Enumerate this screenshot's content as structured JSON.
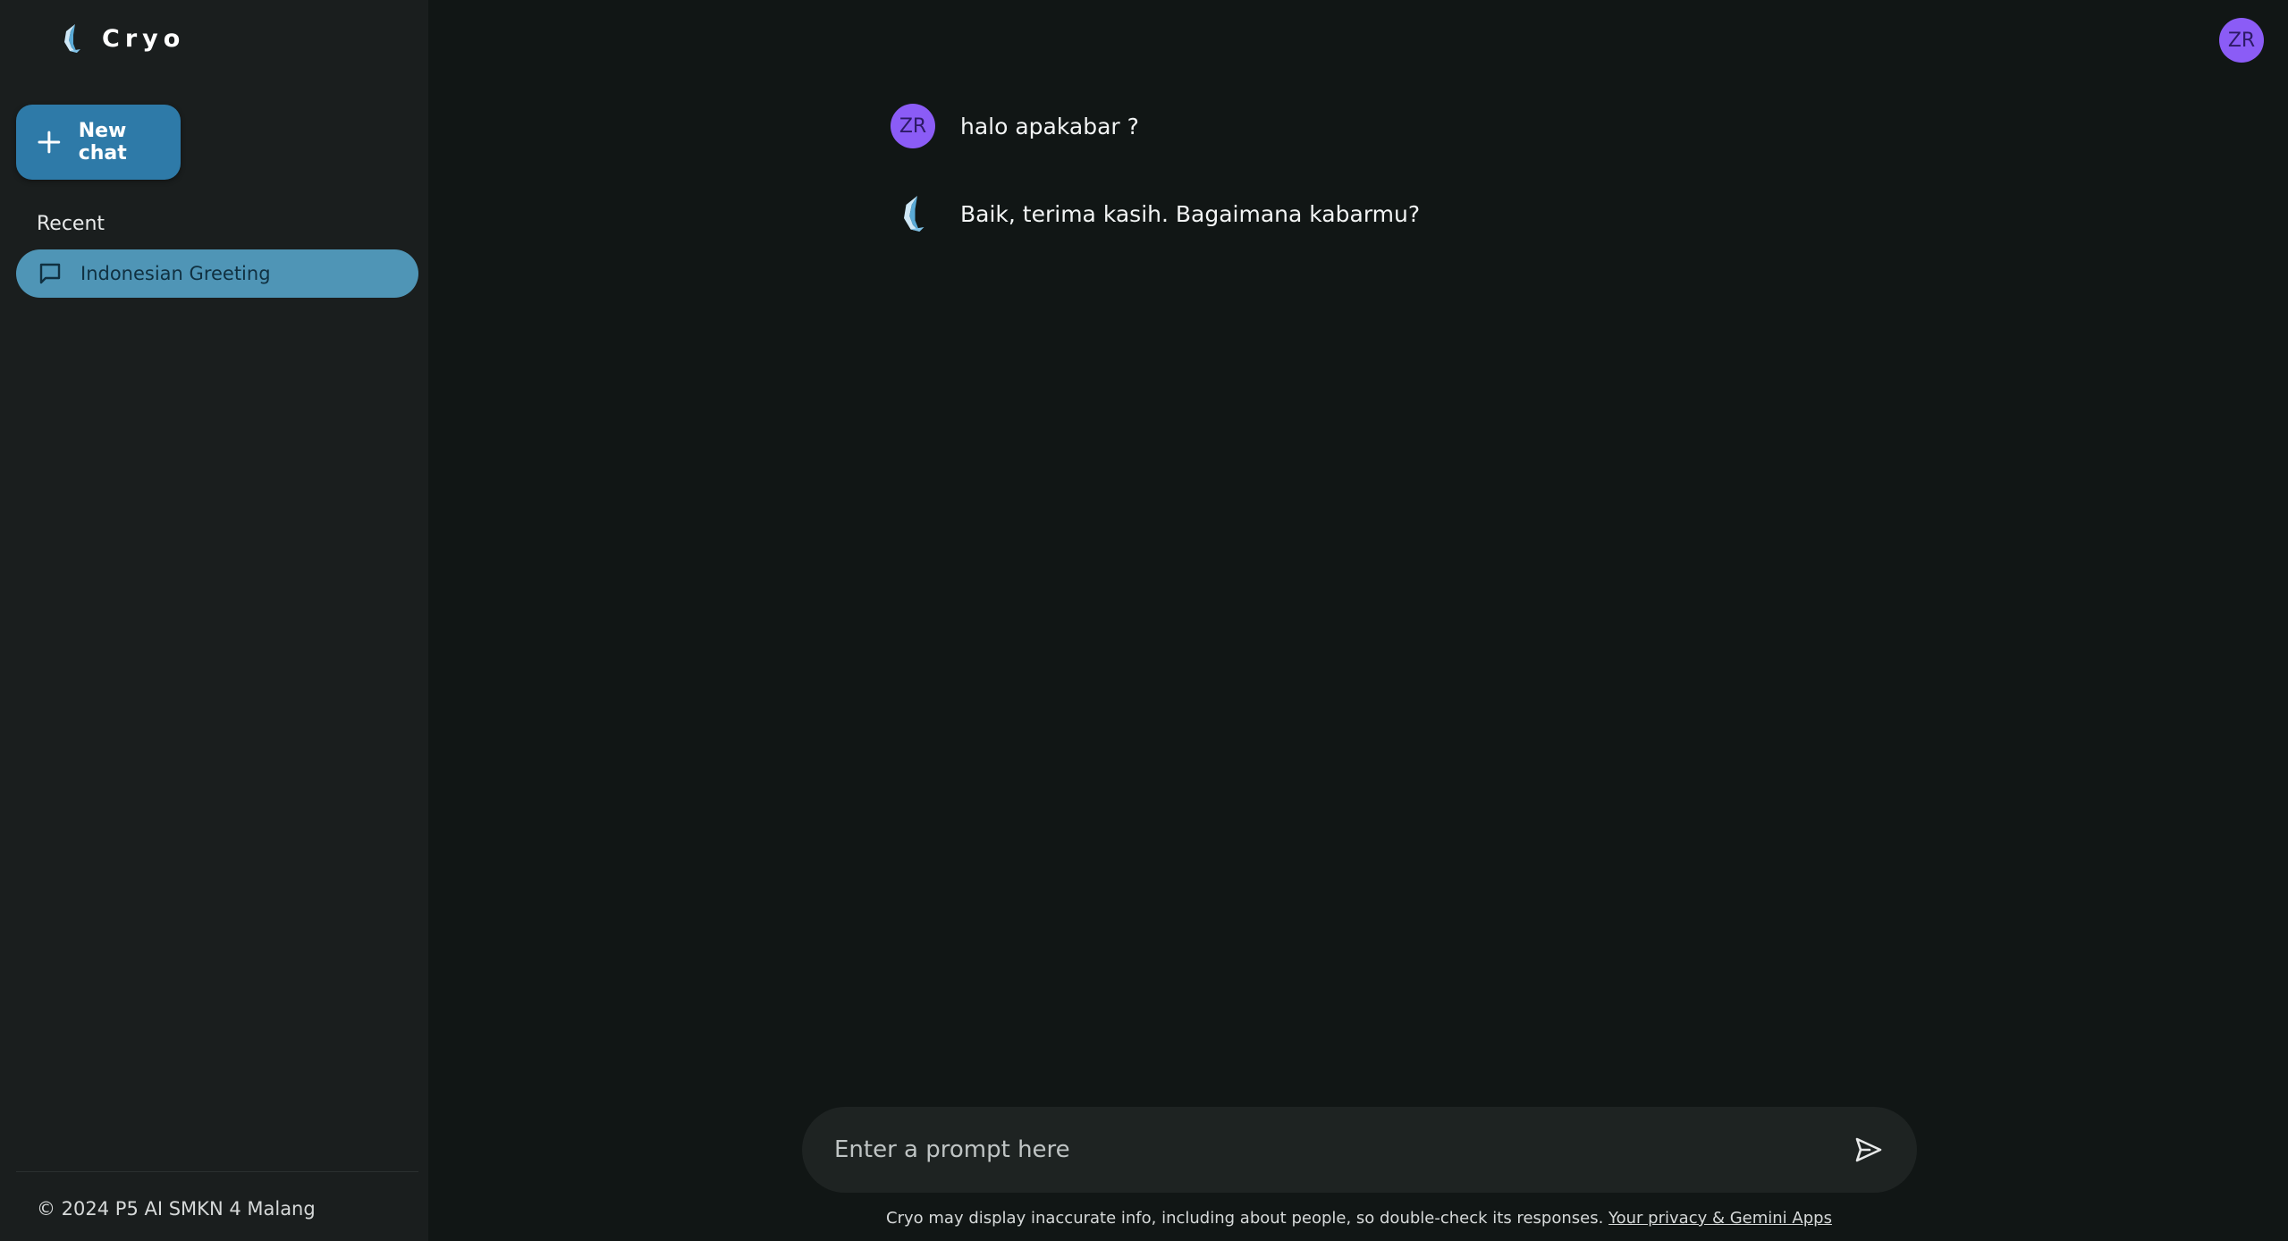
{
  "sidebar": {
    "brand_name": "Cryo",
    "new_chat_label": "New chat",
    "recent_label": "Recent",
    "recent_items": [
      {
        "label": "Indonesian Greeting"
      }
    ],
    "copyright": "© 2024 P5 AI SMKN 4 Malang"
  },
  "header": {
    "user_initials": "ZR"
  },
  "conversation": {
    "messages": [
      {
        "role": "user",
        "initials": "ZR",
        "text": "halo apakabar ?"
      },
      {
        "role": "assistant",
        "text": "Baik, terima kasih. Bagaimana kabarmu?"
      }
    ]
  },
  "prompt": {
    "placeholder": "Enter a prompt here",
    "value": ""
  },
  "footer": {
    "disclaimer": "Cryo may display inaccurate info, including about people, so double-check its responses.",
    "privacy_link": "Your privacy & Gemini Apps"
  },
  "colors": {
    "background": "#111615",
    "sidebar": "#1a1e1e",
    "accent": "#2e7aa8",
    "selected_item": "#4f95b6",
    "avatar": "#8b5cf6"
  },
  "icons": {
    "logo": "cryo-logo-icon",
    "new_chat": "plus-icon",
    "chat_item": "chat-bubble-icon",
    "send": "send-icon"
  }
}
